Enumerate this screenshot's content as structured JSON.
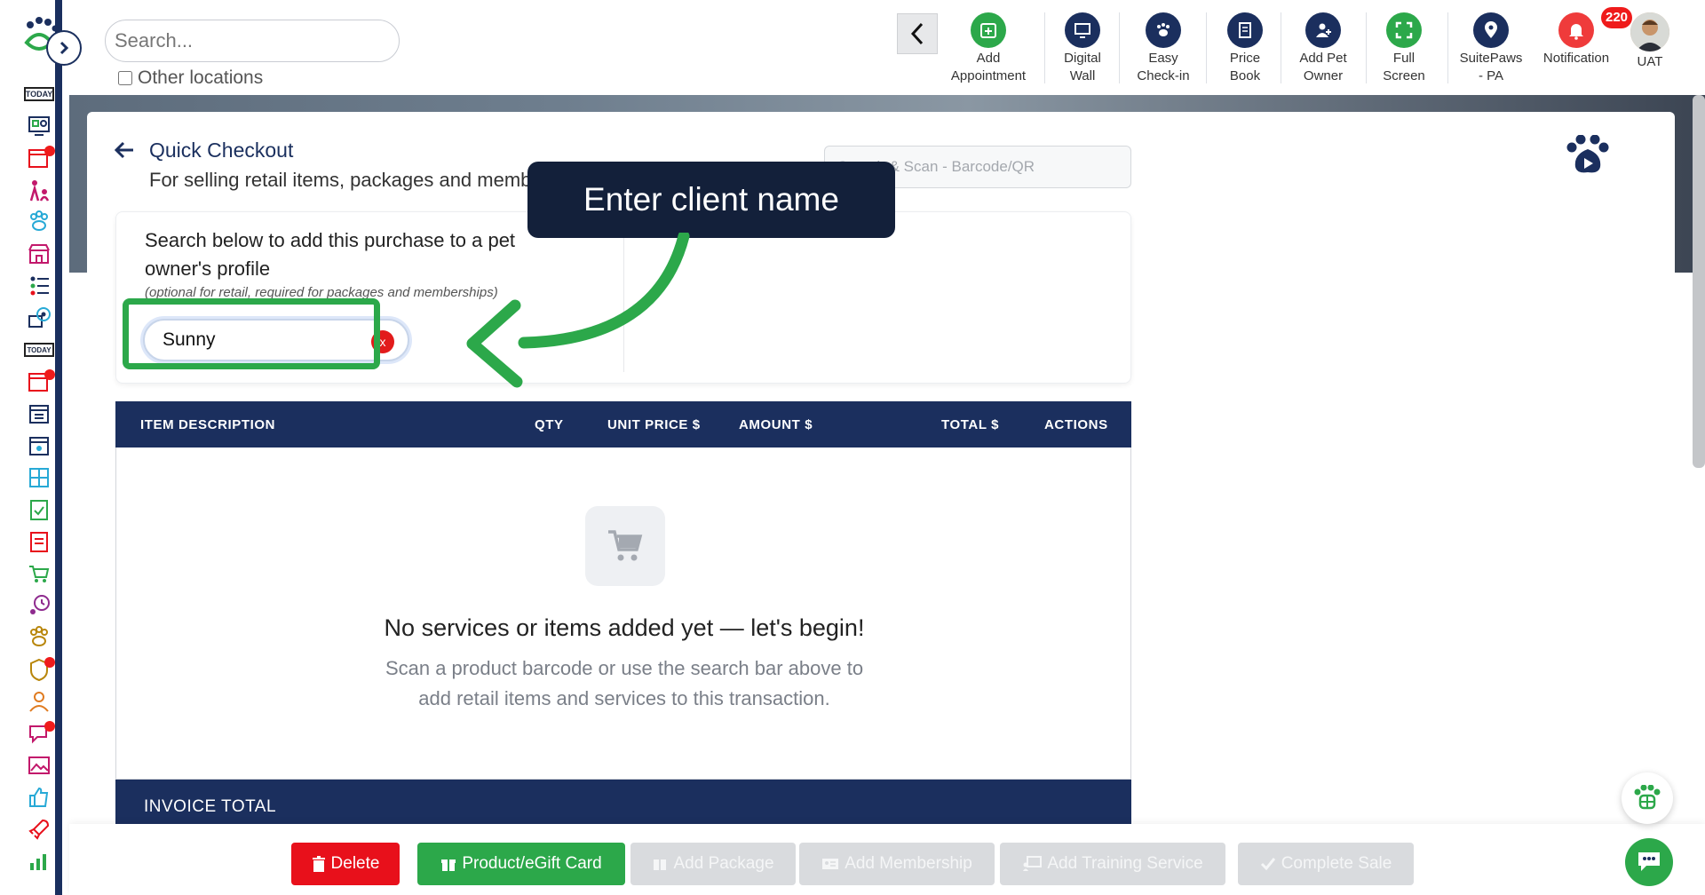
{
  "topbar": {
    "search_placeholder": "Search...",
    "other_locations": "Other locations",
    "tools": [
      {
        "line1": "Add",
        "line2": "Appointment",
        "icon": "calendar-plus-icon",
        "color": "#2ca84a"
      },
      {
        "line1": "Digital",
        "line2": "Wall",
        "icon": "monitor-icon",
        "color": "#1b2f5e"
      },
      {
        "line1": "Easy",
        "line2": "Check-in",
        "icon": "paw-icon",
        "color": "#1b2f5e"
      },
      {
        "line1": "Price",
        "line2": "Book",
        "icon": "document-icon",
        "color": "#1b2f5e"
      },
      {
        "line1": "Add Pet",
        "line2": "Owner",
        "icon": "user-plus-icon",
        "color": "#1b2f5e"
      },
      {
        "line1": "Full",
        "line2": "Screen",
        "icon": "fullscreen-icon",
        "color": "#2ca84a"
      },
      {
        "line1": "SuitePaws",
        "line2": "- PA",
        "icon": "location-pin-icon",
        "color": "#1b2f5e"
      },
      {
        "line1": "Notification",
        "line2": "",
        "icon": "bell-icon",
        "color": "#ef3b3b"
      },
      {
        "line1": "UAT",
        "line2": "",
        "icon": "avatar",
        "color": "#c8a27a"
      }
    ],
    "notification_count": "220"
  },
  "sidebar": {
    "today_label": "TODAY",
    "today_label_2": "TODAY"
  },
  "page": {
    "title": "Quick Checkout",
    "subtitle": "For selling retail items, packages and memb",
    "scan_placeholder": "Search & Scan - Barcode/QR"
  },
  "client": {
    "instructions": "Search below to add this purchase to a pet owner's profile",
    "note": "(optional for retail, required for packages and memberships)",
    "value": "Sunny",
    "clear_label": "x"
  },
  "table": {
    "columns": [
      "ITEM DESCRIPTION",
      "QTY",
      "UNIT PRICE $",
      "AMOUNT $",
      "TOTAL $",
      "ACTIONS"
    ],
    "empty_title": "No services or items added yet — let's begin!",
    "empty_desc_1": "Scan a product barcode or use the search bar above to",
    "empty_desc_2": "add retail items and services to this transaction.",
    "invoice_total": "INVOICE TOTAL"
  },
  "actions": {
    "delete": "Delete",
    "product": "Product/eGift Card",
    "add_package": "Add Package",
    "add_membership": "Add Membership",
    "add_training": "Add Training Service",
    "complete_sale": "Complete Sale"
  },
  "tooltip": {
    "text": "Enter client name"
  },
  "colors": {
    "navy": "#1b2f5e",
    "green": "#2ca84a",
    "red": "#e8101b"
  }
}
